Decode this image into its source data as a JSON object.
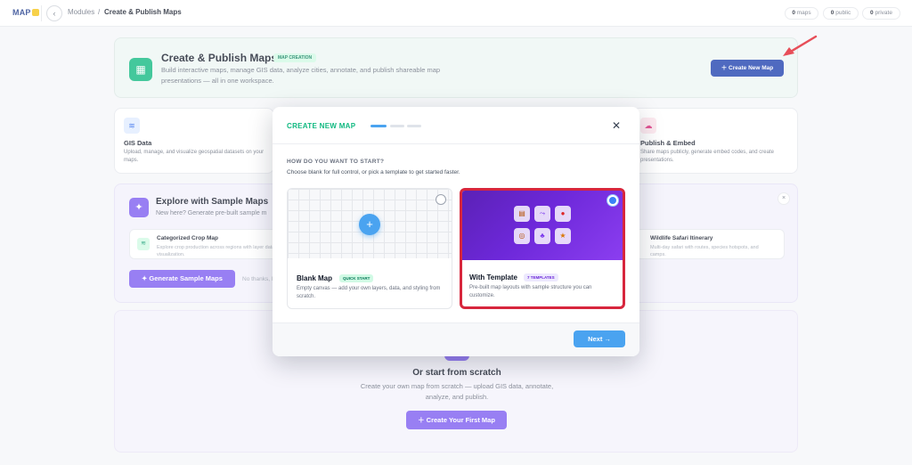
{
  "app": {
    "logo": "MAP",
    "logo_icon": "map-logo-icon"
  },
  "breadcrumb": {
    "modules": "Modules",
    "separator": "/",
    "current": "Create & Publish Maps"
  },
  "stats": [
    {
      "count": "0",
      "label": "maps"
    },
    {
      "count": "0",
      "label": "public"
    },
    {
      "count": "0",
      "label": "private"
    }
  ],
  "hero": {
    "title": "Create & Publish Maps",
    "badge": "MAP CREATION",
    "description": "Build interactive maps, manage GIS data, analyze cities, annotate, and publish shareable map presentations — all in one workspace.",
    "button": "Create New Map",
    "icon": "map-icon"
  },
  "features": [
    {
      "title": "GIS Data",
      "description": "Upload, manage, and visualize geospatial datasets on your maps.",
      "icon": "layers-icon"
    },
    {
      "title": "Publish & Embed",
      "description": "Share maps publicly, generate embed codes, and create presentations.",
      "icon": "cloud-upload-icon"
    }
  ],
  "samples": {
    "title": "Explore with Sample Maps",
    "subtitle": "New here? Generate pre-built sample m",
    "items": [
      {
        "title": "Categorized Crop Map",
        "description": "Explore crop production across regions with layer data visualization."
      },
      {
        "title": "Wildlife Safari Itinerary",
        "description": "Multi-day safari with routes, species hotspots, and camps."
      }
    ],
    "generate_button": "Generate Sample Maps",
    "dismiss": "No thanks, I"
  },
  "scratch": {
    "title": "Or start from scratch",
    "description": "Create your own map from scratch — upload GIS data, annotate, analyze, and publish.",
    "button": "Create Your First Map"
  },
  "modal": {
    "title": "CREATE NEW MAP",
    "question": "HOW DO YOU WANT TO START?",
    "hint": "Choose blank for full control, or pick a template to get started faster.",
    "options": [
      {
        "name": "Blank Map",
        "badge": "QUICK START",
        "description": "Empty canvas — add your own layers, data, and styling from scratch.",
        "selected": false
      },
      {
        "name": "With Template",
        "badge": "7 TEMPLATES",
        "description": "Pre-built map layouts with sample structure you can customize.",
        "selected": true
      }
    ],
    "next_button": "Next →",
    "close_icon": "close-icon"
  },
  "colors": {
    "accent": "#1e40af",
    "brand_green": "#10b981",
    "purple": "#7c5cf0",
    "highlight_red": "#d7263d"
  }
}
